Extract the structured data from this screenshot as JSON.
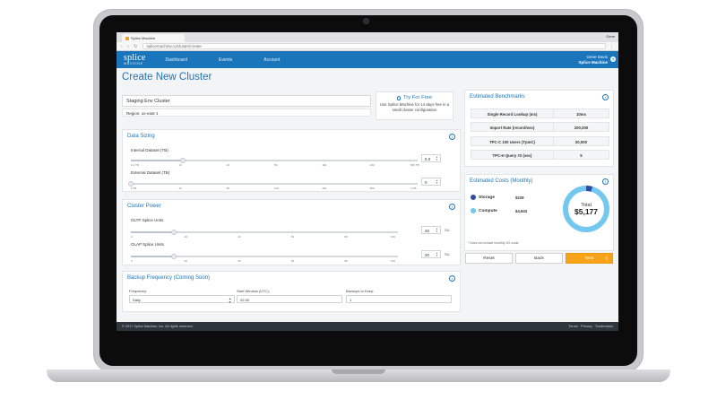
{
  "browser": {
    "tab_title": "Splice Machine",
    "profile_name": "Gene",
    "url": "splicemachine.io/cluster/create",
    "url_host": "splicemachine.io"
  },
  "app": {
    "logo_main": "splice",
    "logo_sub": "MACHINE",
    "nav": [
      "Dashboard",
      "Events",
      "Account"
    ],
    "user_name": "Gene Davis",
    "user_org": "Splice Machine",
    "help_icon": "help-icon"
  },
  "page": {
    "title": "Create New Cluster",
    "cluster_name": "Staging Env Cluster",
    "region": "Region: us-east-1"
  },
  "try_free": {
    "title": "Try For Free",
    "text": "Use Splice Machine for 14 days free in a small cluster configuration"
  },
  "data_sizing": {
    "title": "Data Sizing",
    "internal_label": "Internal Dataset (TB)",
    "internal_value": "5.0",
    "internal_ticks": [
      "0.1 TB",
      "10",
      "20",
      "50",
      "100",
      "200",
      "500 TB"
    ],
    "internal_fraction": 0.18,
    "external_label": "External Dataset (TB)",
    "external_value": "0",
    "external_ticks": [
      "0 TB",
      "10",
      "50",
      "100",
      "200",
      "500",
      "1 PB"
    ],
    "external_fraction": 0.0
  },
  "cluster_power": {
    "title": "Cluster Power",
    "oltp_label": "OLTP Splice Units",
    "oltp_value": "20",
    "oltp_ticks": [
      "4",
      "20",
      "40",
      "60",
      "80",
      "100"
    ],
    "oltp_fraction": 0.16,
    "olap_label": "OLAP Splice Units",
    "olap_value": "20",
    "olap_ticks": [
      "4",
      "20",
      "40",
      "60",
      "80",
      "100"
    ],
    "olap_fraction": 0.16,
    "unit": "SU"
  },
  "backup": {
    "title": "Backup Frequency (Coming Soon)",
    "frequency_label": "Frequency:",
    "frequency_value": "Daily",
    "start_label": "Start Window (UTC):",
    "start_value": "02:30",
    "keep_label": "Backups to Keep:",
    "keep_value": "1"
  },
  "benchmarks": {
    "title": "Estimated Benchmarks",
    "rows": [
      {
        "label": "Single Record Lookup (ms)",
        "value": "10ms"
      },
      {
        "label": "Import Rate (record/sec)",
        "value": "200,000"
      },
      {
        "label": "TPC-C 100 Users (TpmC)",
        "value": "20,000"
      },
      {
        "label": "TPC-H Query #2 (sec)",
        "value": "5"
      }
    ]
  },
  "costs": {
    "title": "Estimated Costs (Monthly)",
    "storage_label": "Storage",
    "storage_value": "$229",
    "compute_label": "Compute",
    "compute_value": "$4,943",
    "total_label": "Total",
    "total_value": "$5,177",
    "note": "* Does not include monthly I/O costs",
    "storage_color": "#2e4ea1",
    "compute_color": "#74c8f0",
    "storage_amount": 229,
    "compute_amount": 4943
  },
  "actions": {
    "reset": "Reset",
    "back": "Back",
    "next": "Next",
    "next_arrow": "›"
  },
  "footer": {
    "copyright": "© 2017 Splice Machine, Inc. All rights reserved.",
    "links": "Terms · Privacy · Trademarks"
  }
}
